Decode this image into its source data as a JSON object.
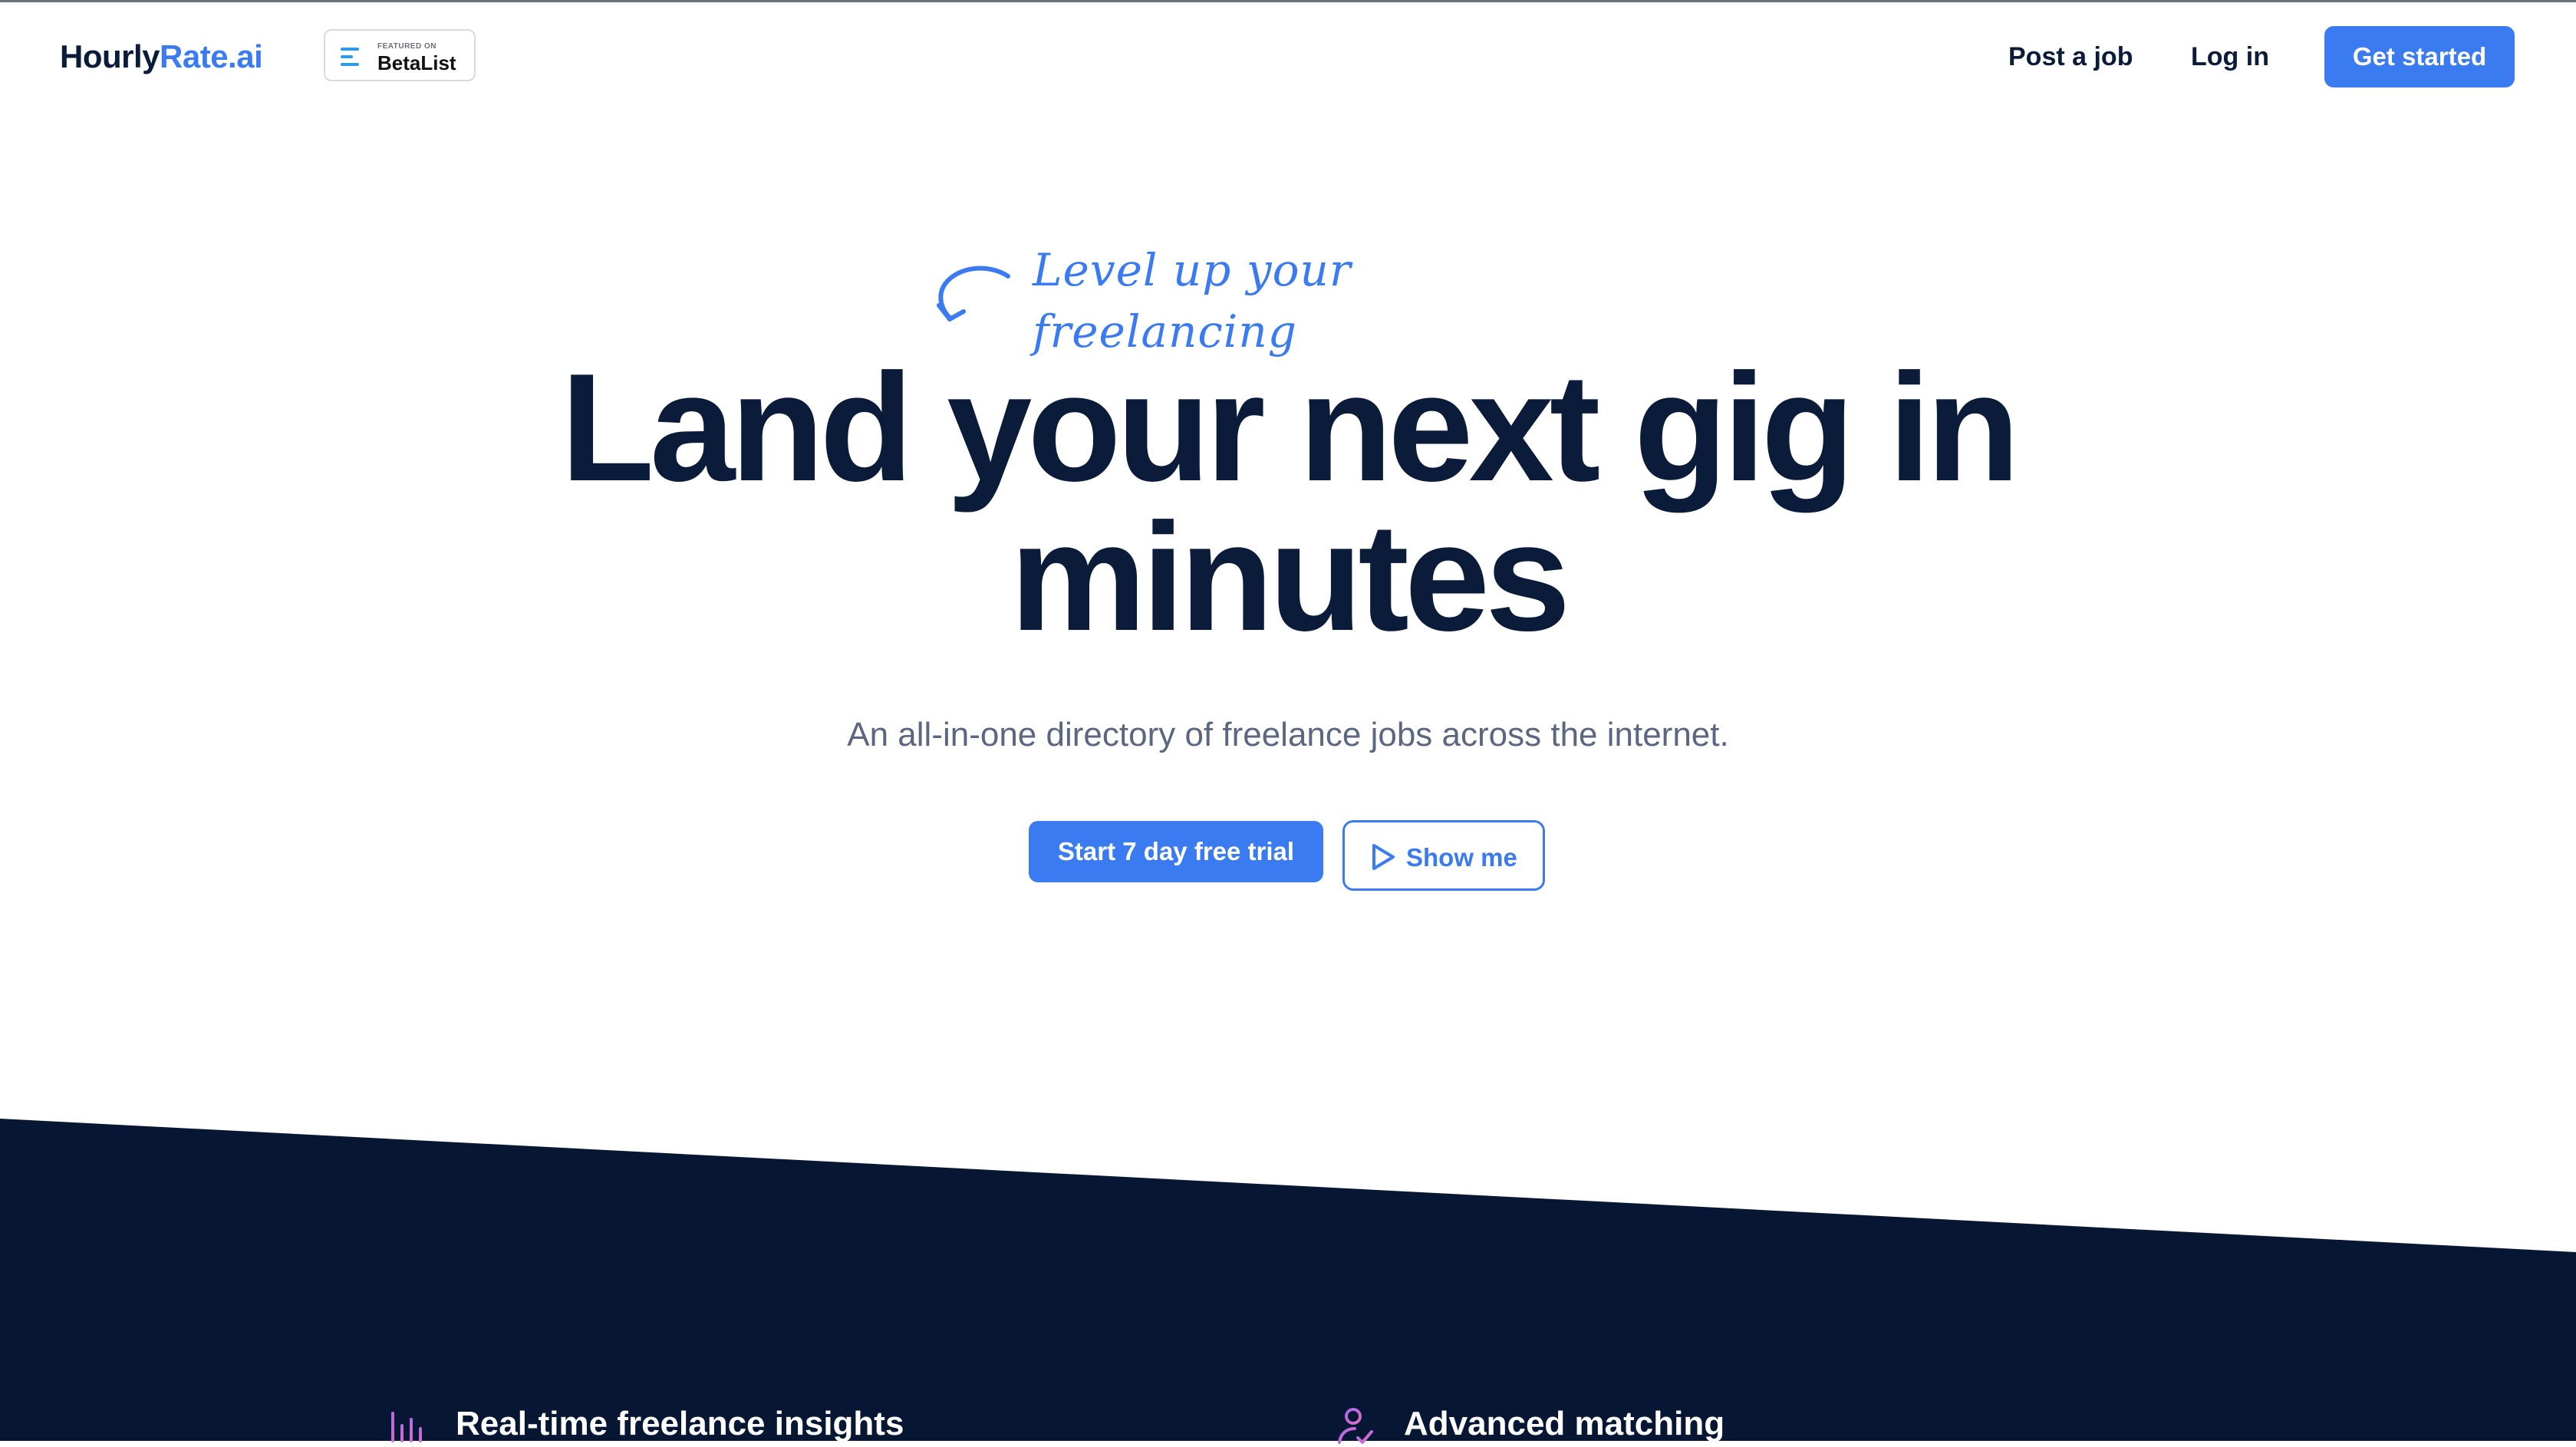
{
  "header": {
    "logo_primary": "Hourly",
    "logo_accent": "Rate.ai",
    "badge": {
      "small_text": "FEATURED ON",
      "name": "BetaList",
      "icon": "betalist-icon"
    },
    "nav": {
      "post_job": "Post a job",
      "login": "Log in",
      "get_started": "Get started"
    }
  },
  "hero": {
    "tagline": "Level up your freelancing",
    "headline_line1": "Land your next gig in",
    "headline_line2": "minutes",
    "subtitle": "An all-in-one directory of freelance jobs across the internet.",
    "primary_cta": "Start 7 day free trial",
    "secondary_cta": "Show me",
    "secondary_icon": "play-icon"
  },
  "features": {
    "items": [
      {
        "label": "Real-time freelance insights",
        "icon": "bar-chart-icon"
      },
      {
        "label": "Advanced matching",
        "icon": "user-match-icon"
      }
    ]
  },
  "colors": {
    "brand": "#3b7bf1",
    "dark": "#0b1b3a",
    "dark_section": "#071733",
    "muted": "#5b6680",
    "icon_gradient": "#c46ad8"
  }
}
